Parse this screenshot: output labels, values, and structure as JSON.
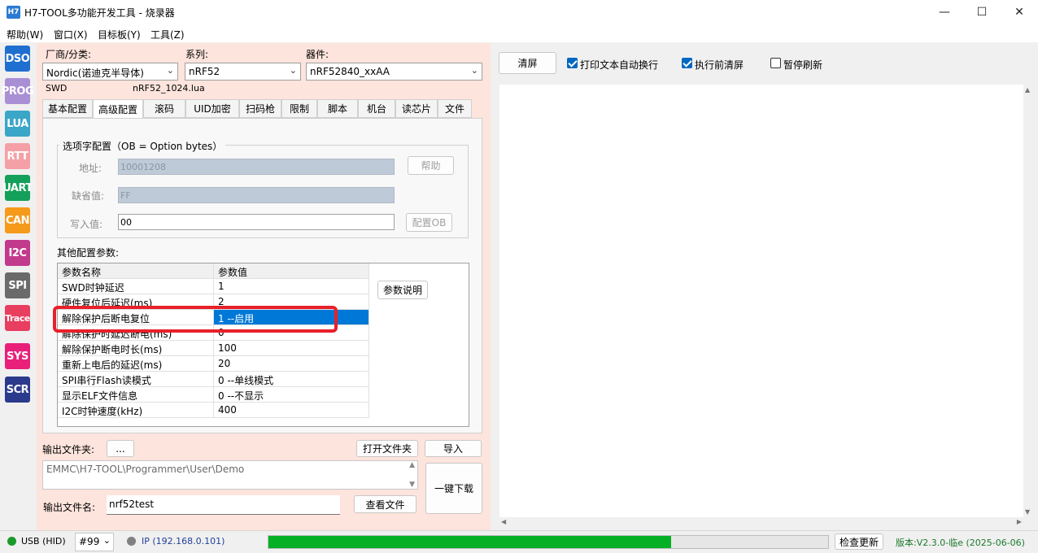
{
  "window": {
    "app_icon": "H7",
    "title": "H7-TOOL多功能开发工具 - 烧录器",
    "minimize": "—",
    "maximize": "☐",
    "close": "✕"
  },
  "menu": [
    "帮助(W)",
    "窗口(X)",
    "目标板(Y)",
    "工具(Z)"
  ],
  "sidebar": [
    {
      "label": "DSO",
      "color": "#1f6fd1"
    },
    {
      "label": "PROG",
      "color": "#a98fd4"
    },
    {
      "label": "LUA",
      "color": "#3aa6c8"
    },
    {
      "label": "RTT",
      "color": "#f5a0a6"
    },
    {
      "label": "UART",
      "color": "#14a05a"
    },
    {
      "label": "CAN",
      "color": "#f59a1a"
    },
    {
      "label": "I2C",
      "color": "#c23a8c"
    },
    {
      "label": "SPI",
      "color": "#6a6a6a"
    },
    {
      "label": "Trace",
      "color": "#e83e60"
    },
    {
      "label": "SYS",
      "color": "#e8207a"
    },
    {
      "label": "SCR",
      "color": "#2b3a8c"
    }
  ],
  "selector": {
    "vendor_label": "厂商/分类:",
    "vendor_value": "Nordic(诺迪克半导体)",
    "series_label": "系列:",
    "series_value": "nRF52",
    "device_label": "器件:",
    "device_value": "nRF52840_xxAA",
    "interface": "SWD",
    "lua_file": "nRF52_1024.lua"
  },
  "tabs": [
    "基本配置",
    "高级配置",
    "滚码",
    "UID加密",
    "扫码枪",
    "限制",
    "脚本",
    "机台",
    "读芯片",
    "文件"
  ],
  "active_tab": "高级配置",
  "option_bytes": {
    "title": "选项字配置（OB = Option bytes）",
    "address_label": "地址:",
    "address_value": "10001208",
    "default_label": "缺省值:",
    "default_value": "FF",
    "write_label": "写入值:",
    "write_value": "00",
    "help_button": "帮助",
    "config_button": "配置OB"
  },
  "other_params": {
    "label": "其他配置参数:",
    "col_name": "参数名称",
    "col_value": "参数值",
    "rows": [
      {
        "name": "SWD时钟延迟",
        "value": "1"
      },
      {
        "name": "硬件复位后延迟(ms)",
        "value": "2"
      },
      {
        "name": "解除保护后断电复位",
        "value": "1 --启用"
      },
      {
        "name": "解除保护时延迟断电(ms)",
        "value": "0"
      },
      {
        "name": "解除保护断电时长(ms)",
        "value": "100"
      },
      {
        "name": "重新上电后的延迟(ms)",
        "value": "20"
      },
      {
        "name": "SPI串行Flash读模式",
        "value": "0 --单线模式"
      },
      {
        "name": "显示ELF文件信息",
        "value": "0 --不显示"
      },
      {
        "name": "I2C时钟速度(kHz)",
        "value": "400"
      }
    ],
    "explain_button": "参数说明"
  },
  "output": {
    "folder_label": "输出文件夹:",
    "browse_button": "...",
    "open_folder_button": "打开文件夹",
    "import_button": "导入",
    "path_value": "EMMC\\H7-TOOL\\Programmer\\User\\Demo",
    "download_button": "一键下载",
    "filename_label": "输出文件名:",
    "filename_value": "nrf52test",
    "view_file_button": "查看文件"
  },
  "log_toolbar": {
    "clear_button": "清屏",
    "wrap_label": "打印文本自动换行",
    "clear_before_label": "执行前清屏",
    "pause_label": "暂停刷新"
  },
  "status": {
    "usb": "USB (HID)",
    "device_num": "#99",
    "ip": "IP (192.168.0.101)",
    "progress": 0.72,
    "update_button": "检查更新",
    "version": "版本:V2.3.0-临e (2025-06-06)"
  }
}
